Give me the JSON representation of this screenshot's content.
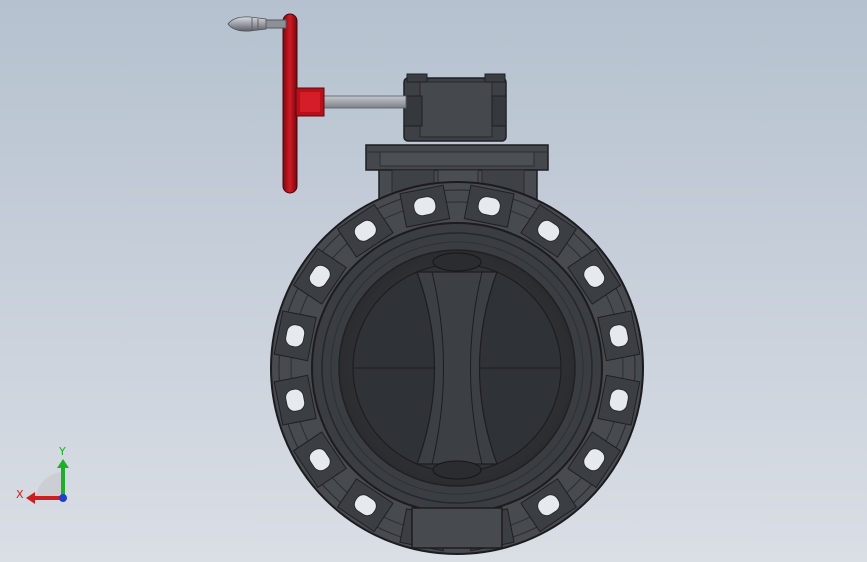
{
  "viewport": {
    "background_top": "#b8c4d2",
    "background_bottom": "#d9dde4"
  },
  "model": {
    "body_color": "#474a4f",
    "body_dark": "#2e3034",
    "disc_color": "#3a3d42",
    "handwheel_color": "#c8102e",
    "shaft_color": "#9a9ea4",
    "handle_color": "#a8acb2"
  },
  "triad": {
    "x_label": "X",
    "y_label": "Y",
    "x_color": "#cc1f1f",
    "y_color": "#1fae2a",
    "z_color": "#1f3fcc"
  }
}
